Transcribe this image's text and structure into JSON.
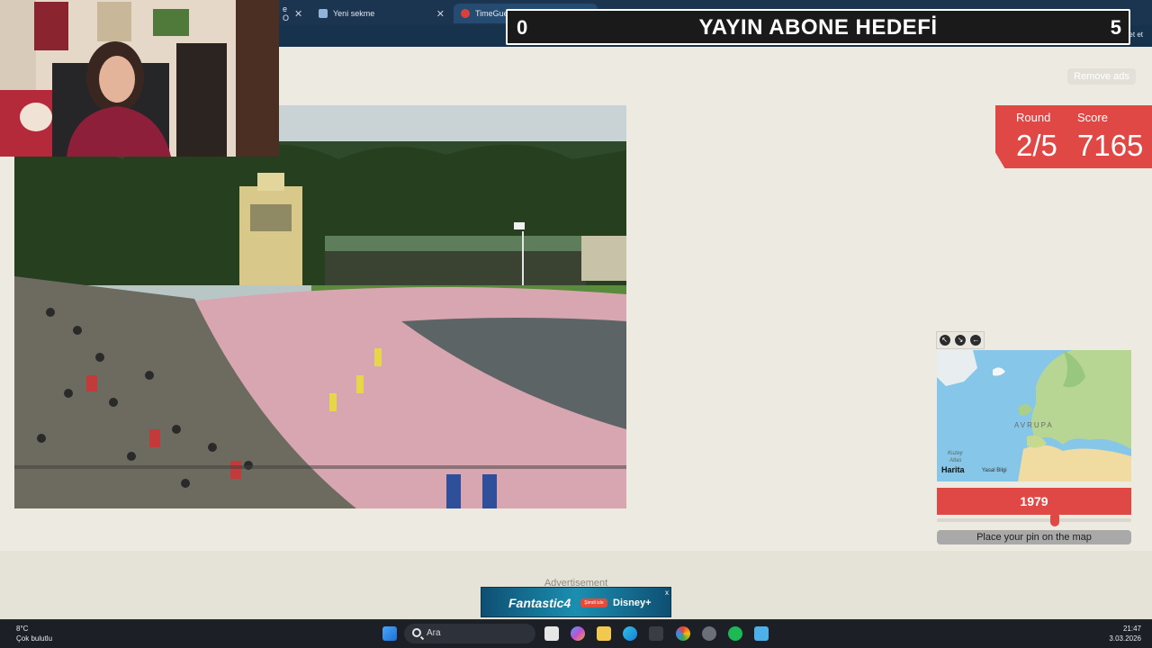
{
  "browser": {
    "tabs": [
      {
        "label": "e O",
        "active": false
      },
      {
        "label": "Yeni sekme",
        "active": false
      },
      {
        "label": "TimeGuessr - Round Two",
        "active": true
      }
    ],
    "new_tab_symbol": "+",
    "sohbet_label": "Sohbet et"
  },
  "overlay": {
    "sub_goal_title": "YAYIN ABONE HEDEFİ",
    "sub_current": "0",
    "sub_goal": "5"
  },
  "game": {
    "remove_ads_label": "Remove ads",
    "round_label": "Round",
    "round_value": "2/5",
    "score_label": "Score",
    "score_value": "7165",
    "year_value": "1979",
    "year_slider_fraction": 0.61,
    "place_pin_label": "Place your pin on the map"
  },
  "map": {
    "region_label": "AVRUPA",
    "north_atlantic_line1": "Kuzey",
    "north_atlantic_line2": "Atlas",
    "brand_label": "Harita",
    "legal_label": "Yasal Bilgi"
  },
  "advertisement": {
    "label": "Advertisement",
    "banner_title": "Fantastic4",
    "banner_cta": "Şimdi izle",
    "banner_brand": "Disney+",
    "close_symbol": "x"
  },
  "taskbar": {
    "temperature": "8°C",
    "weather": "Çok bulutlu",
    "search_label": "Ara",
    "time": "21:47",
    "date": "3.03.2026"
  }
}
